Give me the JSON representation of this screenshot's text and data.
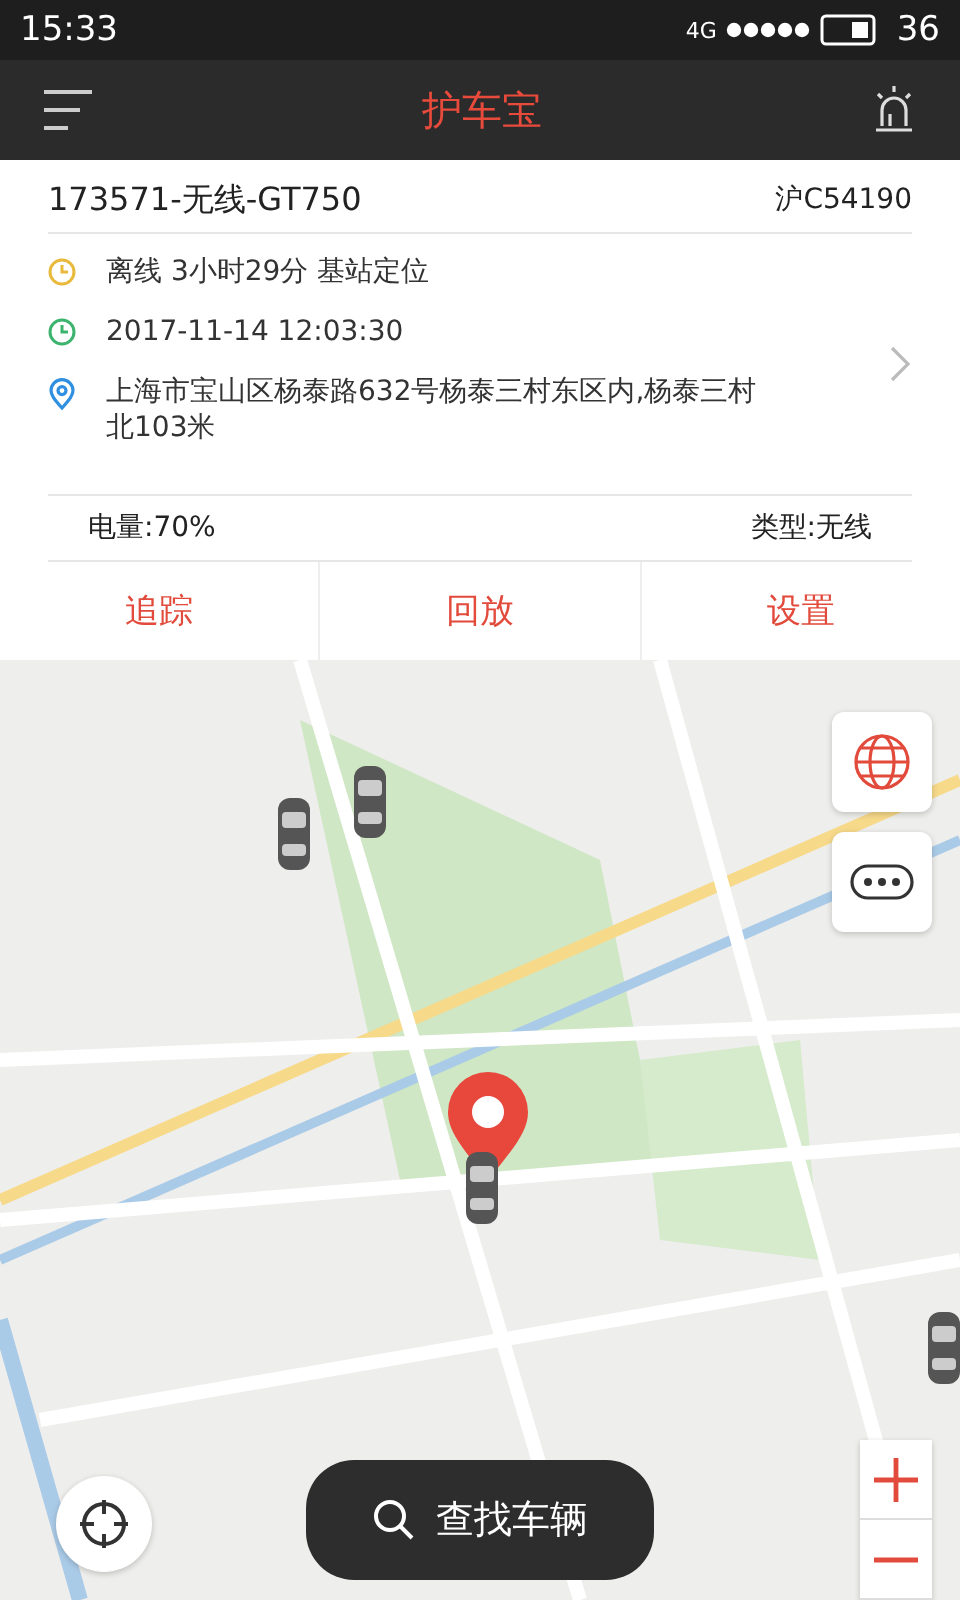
{
  "status_bar": {
    "time": "15:33",
    "network": "4G",
    "battery": "36"
  },
  "header": {
    "title": "护车宝"
  },
  "device": {
    "name": "173571-无线-GT750",
    "plate": "沪C54190",
    "details": [
      {
        "kind": "status",
        "text": "离线 3小时29分 基站定位"
      },
      {
        "kind": "time",
        "text": "2017-11-14 12:03:30"
      },
      {
        "kind": "address",
        "text": "上海市宝山区杨泰路632号杨泰三村东区内,杨泰三村北103米"
      }
    ],
    "battery": "电量:70%",
    "type": "类型:无线"
  },
  "actions": [
    "追踪",
    "回放",
    "设置"
  ],
  "map": {
    "search_button": "查找车辆"
  }
}
